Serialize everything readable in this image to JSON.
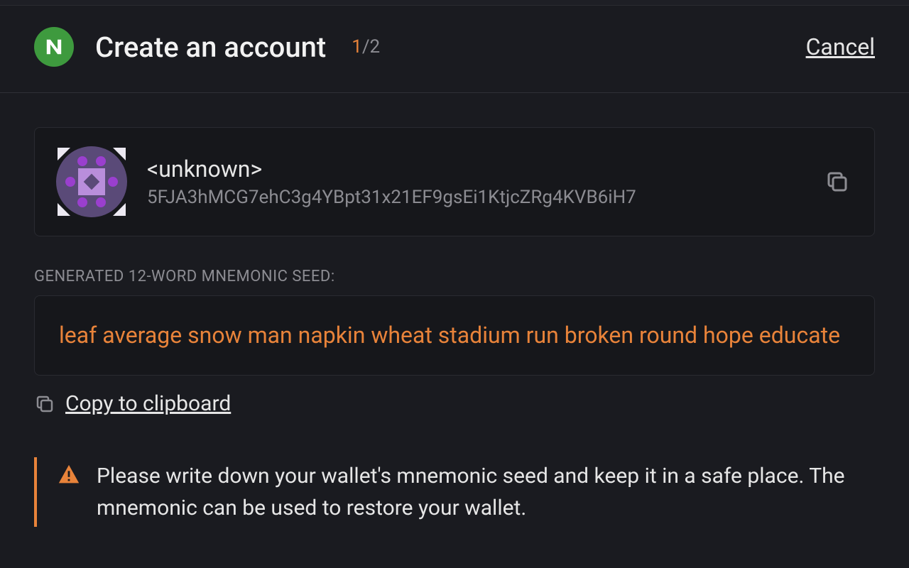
{
  "header": {
    "title": "Create an account",
    "step_current": "1",
    "step_total": "/2",
    "cancel": "Cancel"
  },
  "account": {
    "name": "<unknown>",
    "address": "5FJA3hMCG7ehC3g4YBpt31x21EF9gsEi1KtjcZRg4KVB6iH7"
  },
  "seed": {
    "label": "Generated 12-word mnemonic seed:",
    "phrase": "leaf average snow man napkin wheat stadium run broken round hope educate",
    "copy_label": "Copy to clipboard"
  },
  "warning": {
    "text": "Please write down your wallet's mnemonic seed and keep it in a safe place. The mnemonic can be used to restore your wallet."
  },
  "colors": {
    "accent": "#e8833a",
    "bg": "#1a1b20",
    "card": "#16171b"
  }
}
